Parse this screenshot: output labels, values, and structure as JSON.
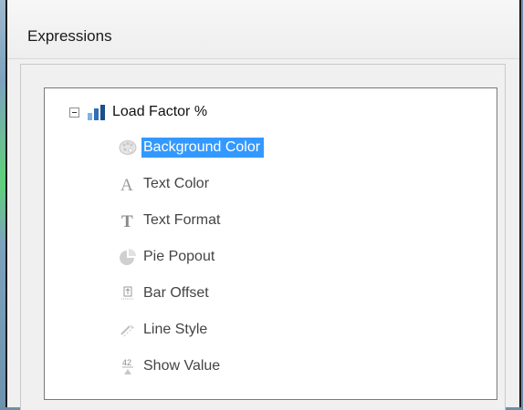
{
  "dialog": {
    "title": "Expressions"
  },
  "tree": {
    "root": {
      "label": "Load Factor %",
      "icon": "bar-chart-icon",
      "expanded": true
    },
    "items": [
      {
        "label": "Background Color",
        "icon": "palette-icon",
        "selected": true
      },
      {
        "label": "Text Color",
        "icon": "text-color-icon",
        "selected": false
      },
      {
        "label": "Text Format",
        "icon": "text-format-icon",
        "selected": false
      },
      {
        "label": "Pie Popout",
        "icon": "pie-popout-icon",
        "selected": false
      },
      {
        "label": "Bar Offset",
        "icon": "bar-offset-icon",
        "selected": false
      },
      {
        "label": "Line Style",
        "icon": "line-style-icon",
        "selected": false
      },
      {
        "label": "Show Value",
        "icon": "show-value-icon",
        "selected": false
      }
    ]
  },
  "colors": {
    "selection": "#3399ff",
    "chart_icon": "#2f6fb5"
  }
}
